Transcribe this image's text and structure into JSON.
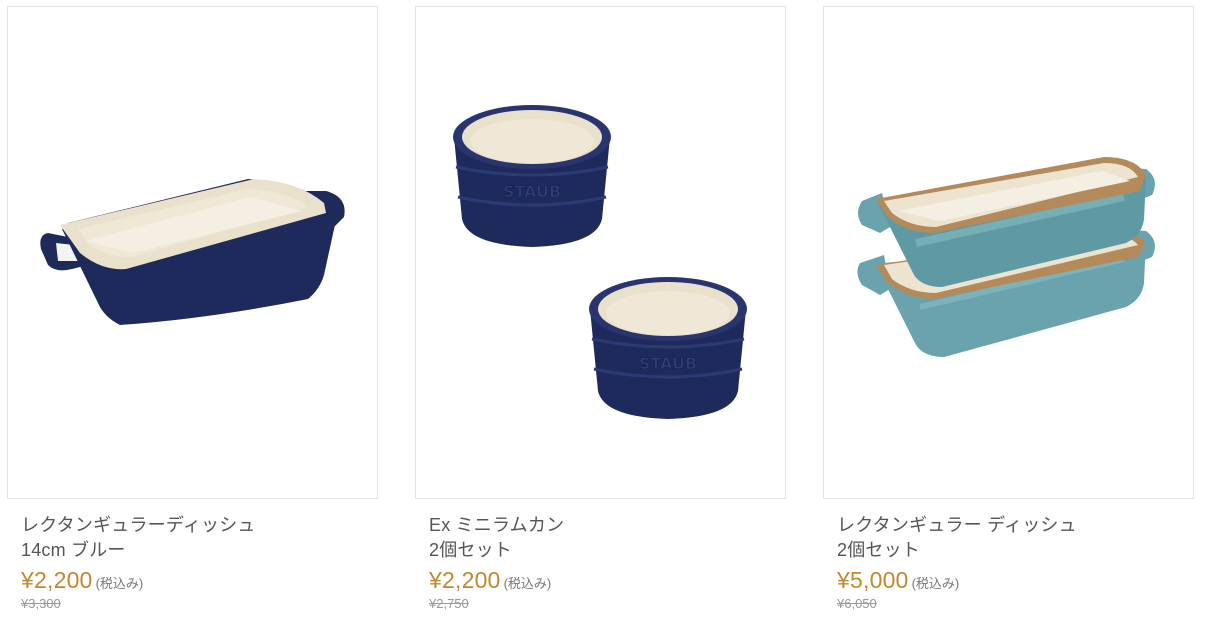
{
  "products": [
    {
      "name_line1": "レクタンギュラーディッシュ",
      "name_line2": "14cm ブルー",
      "price": "¥2,200",
      "tax_label": "(税込み)",
      "original_price": "¥3,300",
      "image_icon": "blue-rectangular-dish-image"
    },
    {
      "name_line1": "Ex ミニラムカン",
      "name_line2": "2個セット",
      "price": "¥2,200",
      "tax_label": "(税込み)",
      "original_price": "¥2,750",
      "image_icon": "blue-ramekin-pair-image",
      "emboss_text": "STAUB"
    },
    {
      "name_line1": "レクタンギュラー ディッシュ",
      "name_line2": "2個セット",
      "price": "¥5,000",
      "tax_label": "(税込み)",
      "original_price": "¥6,050",
      "image_icon": "teal-rectangular-dish-set-image"
    }
  ],
  "colors": {
    "price": "#c2882e",
    "dish_blue": "#1f2a5c",
    "dish_teal": "#6aa3ad",
    "cream": "#efe8d6"
  }
}
